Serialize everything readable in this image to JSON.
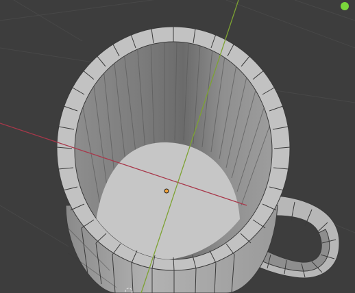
{
  "app": "3D Viewport",
  "scene": {
    "object": "mug",
    "mode": "object",
    "shading": "solid"
  },
  "colors": {
    "background": "#3d3d3d",
    "grid_line": "#484848",
    "x_axis": "#a8374a",
    "y_axis": "#7da232",
    "mesh_face_light": "#c9c9c9",
    "mesh_face_mid": "#a5a5a5",
    "mesh_face_dark": "#747474",
    "mesh_edge": "#3a3a3a",
    "origin": "#f2a33a",
    "gizmo_y": "#7ad83b"
  },
  "icons": {
    "origin": "object-origin-icon",
    "gizmo": "navigation-gizmo-y-icon"
  }
}
